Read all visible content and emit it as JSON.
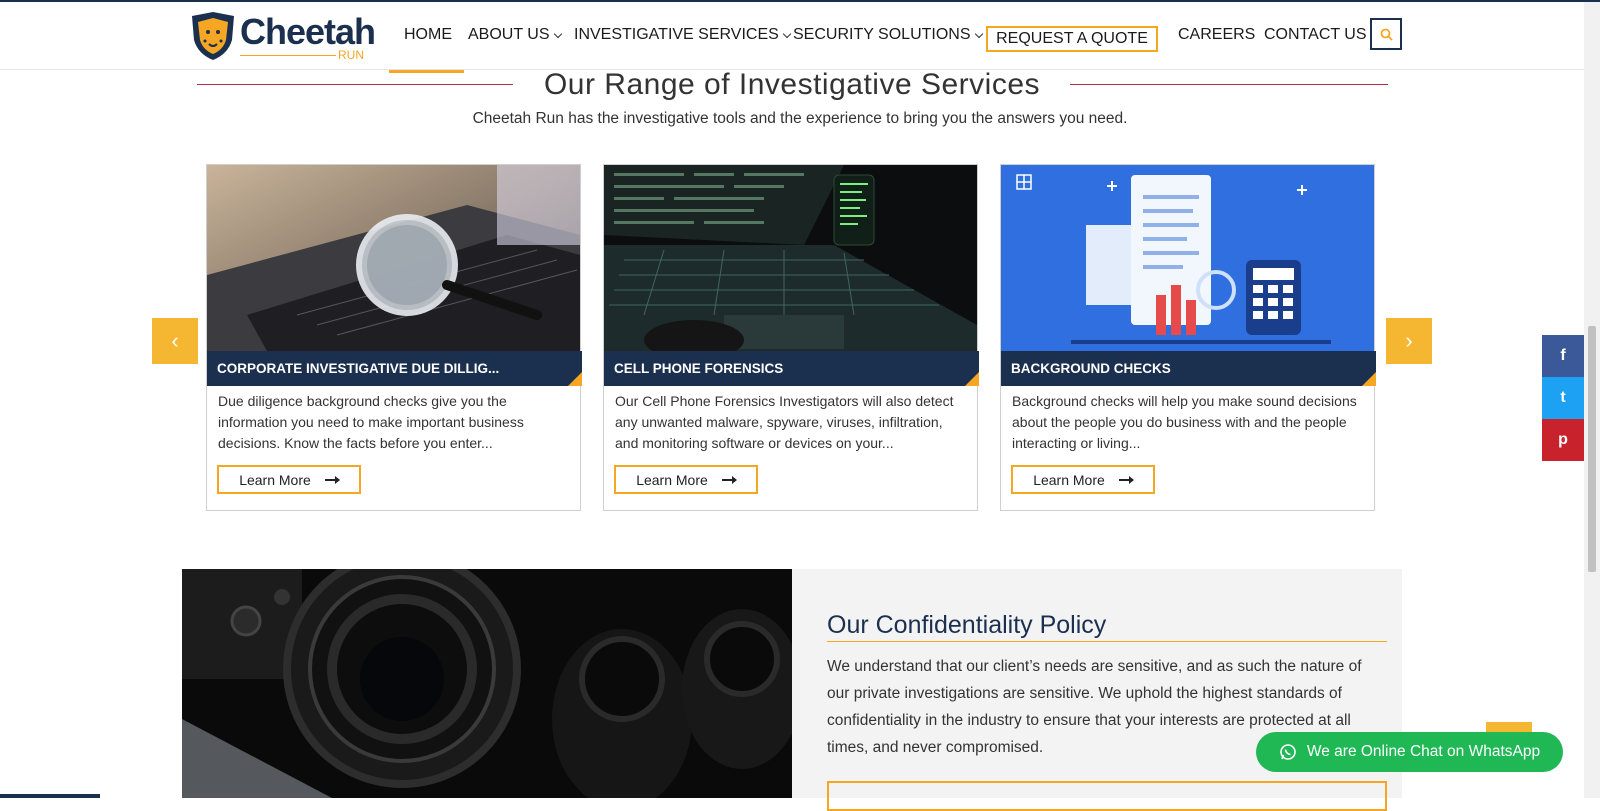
{
  "header": {
    "logo_text": "Cheetah",
    "logo_sub": "RUN",
    "nav": {
      "home": "HOME",
      "about": "ABOUT US",
      "investigative": "INVESTIGATIVE SERVICES",
      "security": "SECURITY SOLUTIONS",
      "quote": "REQUEST A QUOTE",
      "careers": "CAREERS",
      "contact": "CONTACT US"
    },
    "search_icon": "search-icon"
  },
  "services": {
    "title": "Our Range of Investigative Services",
    "subtitle": "Cheetah Run has the investigative tools and the experience to bring you the answers you need.",
    "cards": [
      {
        "title": "CORPORATE INVESTIGATIVE DUE DILLIG...",
        "text": "Due diligence background checks give you the information you need to make important business decisions. Know the facts before you enter...",
        "button": "Learn More"
      },
      {
        "title": "CELL PHONE FORENSICS",
        "text": "Our Cell Phone Forensics Investigators will also detect any unwanted malware, spyware, viruses, infiltration, and monitoring software or devices on your...",
        "button": "Learn More"
      },
      {
        "title": "BACKGROUND CHECKS",
        "text": "Background checks will help you make sound decisions about the people you do business with and the people interacting or living...",
        "button": "Learn More"
      }
    ],
    "prev": "‹",
    "next": "›"
  },
  "social": {
    "facebook": "f",
    "twitter": "t",
    "pinterest": "p"
  },
  "confidentiality": {
    "title": "Our Confidentiality Policy",
    "text": "We understand that our client’s needs are sensitive, and as such the nature of our private investigations are sensitive. We uphold the highest standards of confidentiality in the industry to ensure that your interests are protected at all times, and never compromised."
  },
  "whatsapp": {
    "label": "We are Online Chat on WhatsApp"
  },
  "colors": {
    "navy": "#1b2f4f",
    "gold": "#f5a623",
    "crimson": "#b03049",
    "whatsapp_green": "#1fb855"
  }
}
